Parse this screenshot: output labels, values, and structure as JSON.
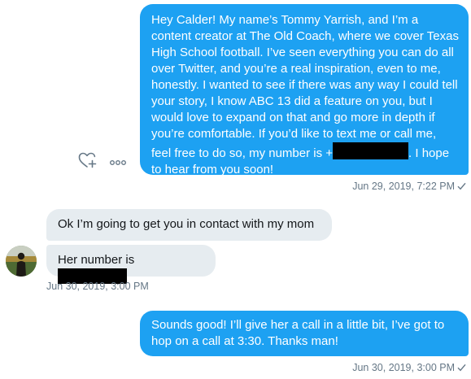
{
  "messages": {
    "m1": {
      "text_before_redaction": "Hey Calder! My name’s Tommy Yarrish, and I’m a content creator at The Old Coach, where we cover Texas High School football. I’ve seen everything you can do all over Twitter, and you’re a real inspiration, even to me, honestly. I wanted to see if there was any way I could tell your story, I know ABC 13 did a feature on you, but I would love to expand on that and go more in depth if you’re comfortable. If you’d like to text me or call me, feel free to do so, my number is +",
      "text_after_redaction": ". I hope to hear from you soon!",
      "timestamp": "Jun 29, 2019, 7:22 PM"
    },
    "m2": {
      "text": "Ok I’m going to get you in contact with my mom"
    },
    "m3": {
      "text": "Her number is ",
      "timestamp": "Jun 30, 2019, 3:00 PM"
    },
    "m4": {
      "text": "Sounds good! I’ll give her a call in a little bit, I’ve got to hop on a call at 3:30. Thanks man!",
      "timestamp": "Jun 30, 2019, 3:00 PM"
    }
  },
  "icons": {
    "react": "heart-plus-icon",
    "more": "more-icon",
    "sent": "checkmark-icon"
  },
  "colors": {
    "outgoing_bubble": "#1da1f2",
    "incoming_bubble": "#e6ecf0",
    "timestamp": "#657786",
    "redaction": "#000000"
  }
}
